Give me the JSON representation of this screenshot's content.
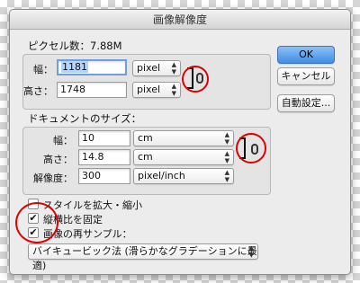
{
  "dialog": {
    "title": "画像解像度",
    "pixel_dimensions": {
      "title": "ピクセル数：7.88M",
      "width_label": "幅：",
      "width_value": "1181",
      "width_unit": "pixel",
      "height_label": "高さ：",
      "height_value": "1748",
      "height_unit": "pixel"
    },
    "document_size": {
      "title": "ドキュメントのサイズ：",
      "width_label": "幅：",
      "width_value": "10",
      "width_unit": "cm",
      "height_label": "高さ：",
      "height_value": "14.8",
      "height_unit": "cm",
      "resolution_label": "解像度：",
      "resolution_value": "300",
      "resolution_unit": "pixel/inch"
    },
    "options": {
      "scale_styles": {
        "label": "スタイルを拡大・縮小",
        "checked": false
      },
      "constrain_proportions": {
        "label": "縦横比を固定",
        "checked": true
      },
      "resample": {
        "label": "画像の再サンプル：",
        "checked": true
      },
      "resample_method": "バイキュービック法 (滑らかなグラデーションに最適)"
    },
    "buttons": {
      "ok": "OK",
      "cancel": "キャンセル",
      "auto": "自動設定..."
    }
  },
  "colors": {
    "annotation": "#e00000",
    "accent": "#3f8ee6"
  }
}
